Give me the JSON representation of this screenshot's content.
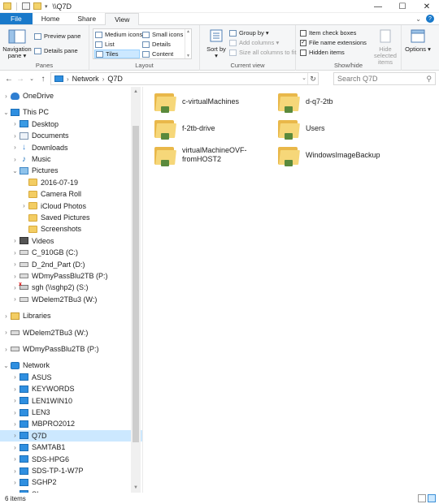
{
  "window": {
    "title": "\\\\Q7D",
    "controls": {
      "minimize": "—",
      "maximize": "☐",
      "close": "✕"
    }
  },
  "tabs": [
    {
      "label": "File"
    },
    {
      "label": "Home"
    },
    {
      "label": "Share"
    },
    {
      "label": "View"
    }
  ],
  "ribbon": {
    "panes": {
      "label": "Panes",
      "navigation_pane": "Navigation pane ▾",
      "preview_pane": "Preview pane",
      "details_pane": "Details pane"
    },
    "layout": {
      "label": "Layout",
      "medium_icons": "Medium icons",
      "small_icons": "Small icons",
      "list": "List",
      "details": "Details",
      "tiles": "Tiles",
      "content": "Content"
    },
    "current_view": {
      "label": "Current view",
      "sort_by": "Sort by ▾",
      "group_by": "Group by ▾",
      "add_columns": "Add columns ▾",
      "size_columns": "Size all columns to fit"
    },
    "show_hide": {
      "label": "Show/hide",
      "item_check_boxes": "Item check boxes",
      "item_check_boxes_checked": false,
      "file_name_extensions": "File name extensions",
      "file_name_extensions_checked": true,
      "hidden_items": "Hidden items",
      "hidden_items_checked": false,
      "hide_selected_items": "Hide selected items"
    },
    "options": "Options ▾"
  },
  "address": {
    "path": [
      "Network",
      "Q7D"
    ],
    "search_placeholder": "Search Q7D"
  },
  "nav": [
    {
      "label": "OneDrive",
      "icon": "cloud",
      "expander": "›",
      "indent": 0,
      "group_start": true
    },
    {
      "label": "This PC",
      "icon": "pc",
      "expander": "⌄",
      "indent": 0,
      "group_start": true
    },
    {
      "label": "Desktop",
      "icon": "desk",
      "expander": "›",
      "indent": 1
    },
    {
      "label": "Documents",
      "icon": "docs",
      "expander": "›",
      "indent": 1
    },
    {
      "label": "Downloads",
      "icon": "down",
      "expander": "›",
      "indent": 1
    },
    {
      "label": "Music",
      "icon": "music",
      "expander": "›",
      "indent": 1
    },
    {
      "label": "Pictures",
      "icon": "pics",
      "expander": "⌄",
      "indent": 1
    },
    {
      "label": "2016-07-19",
      "icon": "folder",
      "expander": "",
      "indent": 2
    },
    {
      "label": "Camera Roll",
      "icon": "folder",
      "expander": "",
      "indent": 2
    },
    {
      "label": "iCloud Photos",
      "icon": "folder",
      "expander": "›",
      "indent": 2
    },
    {
      "label": "Saved Pictures",
      "icon": "folder",
      "expander": "",
      "indent": 2
    },
    {
      "label": "Screenshots",
      "icon": "folder",
      "expander": "",
      "indent": 2
    },
    {
      "label": "Videos",
      "icon": "video",
      "expander": "›",
      "indent": 1
    },
    {
      "label": "C_910GB (C:)",
      "icon": "drive",
      "expander": "›",
      "indent": 1
    },
    {
      "label": "D_2nd_Part (D:)",
      "icon": "drive",
      "expander": "›",
      "indent": 1
    },
    {
      "label": "WDmyPassBlu2TB (P:)",
      "icon": "drive",
      "expander": "›",
      "indent": 1
    },
    {
      "label": "sgh (\\\\sghp2) (S:)",
      "icon": "netdrive-x",
      "expander": "›",
      "indent": 1
    },
    {
      "label": "WDelem2TBu3 (W:)",
      "icon": "drive",
      "expander": "›",
      "indent": 1
    },
    {
      "label": "Libraries",
      "icon": "lib",
      "expander": "›",
      "indent": 0,
      "group_start": true
    },
    {
      "label": "WDelem2TBu3 (W:)",
      "icon": "drive",
      "expander": "›",
      "indent": 0,
      "group_start": true
    },
    {
      "label": "WDmyPassBlu2TB (P:)",
      "icon": "drive",
      "expander": "›",
      "indent": 0,
      "group_start": true
    },
    {
      "label": "Network",
      "icon": "net",
      "expander": "⌄",
      "indent": 0,
      "group_start": true
    },
    {
      "label": "ASUS",
      "icon": "pc",
      "expander": "›",
      "indent": 1
    },
    {
      "label": "KEYWORDS",
      "icon": "pc",
      "expander": "›",
      "indent": 1
    },
    {
      "label": "LEN1WIN10",
      "icon": "pc",
      "expander": "›",
      "indent": 1
    },
    {
      "label": "LEN3",
      "icon": "pc",
      "expander": "›",
      "indent": 1
    },
    {
      "label": "MBPRO2012",
      "icon": "pc",
      "expander": "›",
      "indent": 1
    },
    {
      "label": "Q7D",
      "icon": "pc",
      "expander": "›",
      "indent": 1,
      "selected": true
    },
    {
      "label": "SAMTAB1",
      "icon": "pc",
      "expander": "›",
      "indent": 1
    },
    {
      "label": "SDS-HPG6",
      "icon": "pc",
      "expander": "›",
      "indent": 1
    },
    {
      "label": "SDS-TP-1-W7P",
      "icon": "pc",
      "expander": "›",
      "indent": 1
    },
    {
      "label": "SGHP2",
      "icon": "pc",
      "expander": "›",
      "indent": 1
    },
    {
      "label": "SI",
      "icon": "pc",
      "expander": "›",
      "indent": 1
    }
  ],
  "content": {
    "items": [
      {
        "name": "c-virtualMachines"
      },
      {
        "name": "d-q7-2tb"
      },
      {
        "name": "f-2tb-drive"
      },
      {
        "name": "Users"
      },
      {
        "name": "virtualMachineOVF-fromHOST2"
      },
      {
        "name": "WindowsImageBackup"
      }
    ]
  },
  "status": {
    "item_count": "6 items"
  }
}
